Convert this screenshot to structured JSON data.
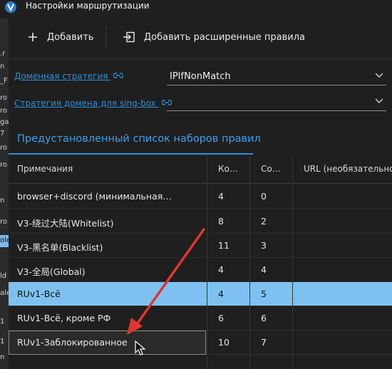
{
  "window": {
    "title": "Настройки маршрутизации"
  },
  "toolbar": {
    "add_label": "Добавить",
    "add_advanced_label": "Добавить расширенные правила"
  },
  "form": {
    "domain_strategy_label": "Доменная стратегия",
    "domain_strategy_value": "IPIfNonMatch",
    "singbox_strategy_label": "Стратегия домена для sing-box",
    "singbox_strategy_value": ""
  },
  "tab": {
    "label": "Предустановленный список наборов правил"
  },
  "table": {
    "columns": [
      "Примечания",
      "Ко…",
      "Co…",
      "URL (необязательно"
    ],
    "rows": [
      {
        "remarks": "browser+discord (минимальная…",
        "count": "4",
        "custom": "0"
      },
      {
        "remarks": "V3-绕过大陆(Whitelist)",
        "count": "8",
        "custom": "2"
      },
      {
        "remarks": "V3-黑名单(Blacklist)",
        "count": "11",
        "custom": "3"
      },
      {
        "remarks": "V3-全局(Global)",
        "count": "4",
        "custom": "4"
      },
      {
        "remarks": "RUv1-Всё",
        "count": "4",
        "custom": "5"
      },
      {
        "remarks": "RUv1-Всё, кроме РФ",
        "count": "6",
        "custom": "6"
      },
      {
        "remarks": "RUv1-Заблокированное",
        "count": "10",
        "custom": "7"
      }
    ],
    "selected_row": 4,
    "focused_row": 6
  },
  "background_window": {
    "fragments": [
      ".r",
      "n",
      "_F",
      "ro",
      "ro",
      "ga",
      "7",
      "ro",
      "ro",
      "n",
      "ro",
      "ole",
      "ld",
      "ale",
      "1",
      "1",
      "n",
      "1"
    ]
  },
  "colors": {
    "accent": "#2f8fdc",
    "selected_row": "#7ec1f0",
    "annotation_arrow": "#e0362d"
  }
}
